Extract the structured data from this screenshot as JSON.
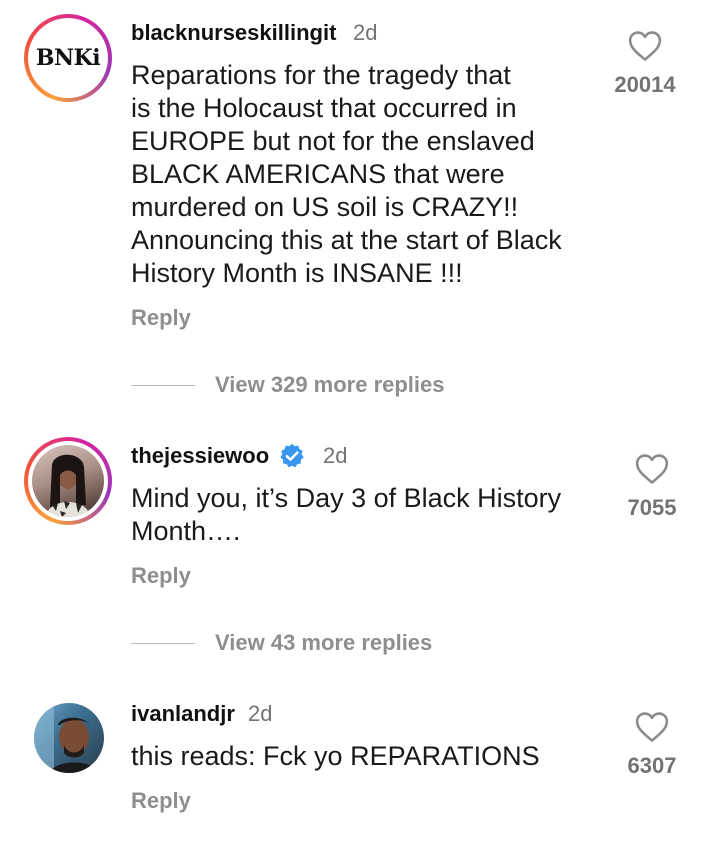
{
  "comments": [
    {
      "avatar_icon": "bnki-logo-avatar",
      "avatar_text": "BNKi",
      "username": "blacknurseskillingit",
      "verified": false,
      "time": "2d",
      "text_lines": [
        "Reparations for the tragedy that",
        "is the Holocaust that occurred in",
        "EUROPE but not for the enslaved",
        "BLACK AMERICANS that were",
        "murdered on US soil is CRAZY!!",
        "Announcing this at the start of Black",
        "History Month is INSANE !!!"
      ],
      "reply_label": "Reply",
      "likes": "20014",
      "view_replies": "View 329 more replies"
    },
    {
      "avatar_icon": "profile-photo-avatar",
      "username": "thejessiewoo",
      "verified": true,
      "time": "2d",
      "text_lines": [
        "Mind you, it’s Day 3 of Black History",
        "Month…."
      ],
      "reply_label": "Reply",
      "likes": "7055",
      "view_replies": "View 43 more replies"
    },
    {
      "avatar_icon": "profile-photo-avatar",
      "username": "ivanlandjr",
      "verified": false,
      "time": "2d",
      "text_lines": [
        "this reads: Fck yo REPARATIONS"
      ],
      "reply_label": "Reply",
      "likes": "6307"
    }
  ],
  "colors": {
    "username": "#111111",
    "secondary": "#737373",
    "reply": "#8e8e8e",
    "verified": "#3897f0",
    "ring_orange": "#f9a23a",
    "ring_pink": "#d6249f"
  }
}
